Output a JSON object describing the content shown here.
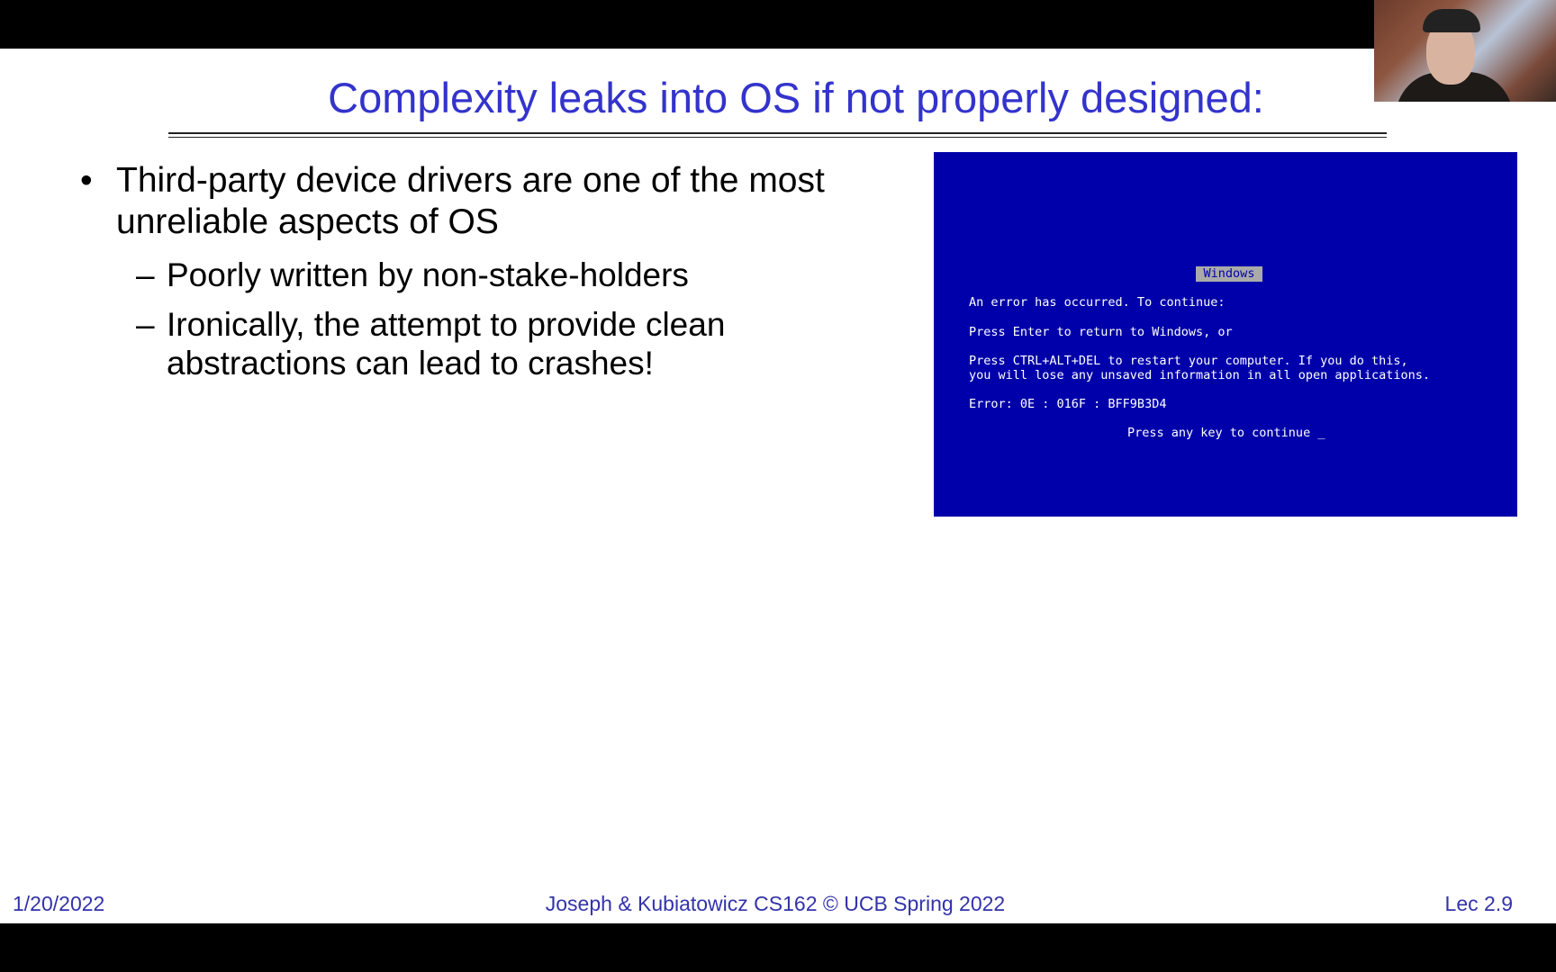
{
  "slide": {
    "title": "Complexity leaks into OS if not properly designed:",
    "bullets": [
      {
        "marker": "•",
        "text": "Third-party device drivers are one of the most unreliable aspects of OS",
        "subitems": [
          {
            "marker": "–",
            "text": "Poorly written by non-stake-holders"
          },
          {
            "marker": "–",
            "text": "Ironically, the attempt to provide clean abstractions can lead to crashes!"
          }
        ]
      }
    ],
    "bsod": {
      "header": "Windows",
      "line1": "An error has occurred. To continue:",
      "line2": "Press Enter to return to Windows, or",
      "line3a": "Press CTRL+ALT+DEL to restart your computer. If you do this,",
      "line3b": "you will lose any unsaved information in all open applications.",
      "line4": "Error: 0E : 016F : BFF9B3D4",
      "line5": "Press any key to continue _"
    },
    "footer": {
      "date": "1/20/2022",
      "center": "Joseph & Kubiatowicz CS162 © UCB Spring 2022",
      "lecture": "Lec 2.9"
    }
  },
  "colors": {
    "title": "#3333cc",
    "footer": "#3333aa",
    "bsod_background": "#0000aa",
    "bsod_header_background": "#aaaaaa"
  }
}
